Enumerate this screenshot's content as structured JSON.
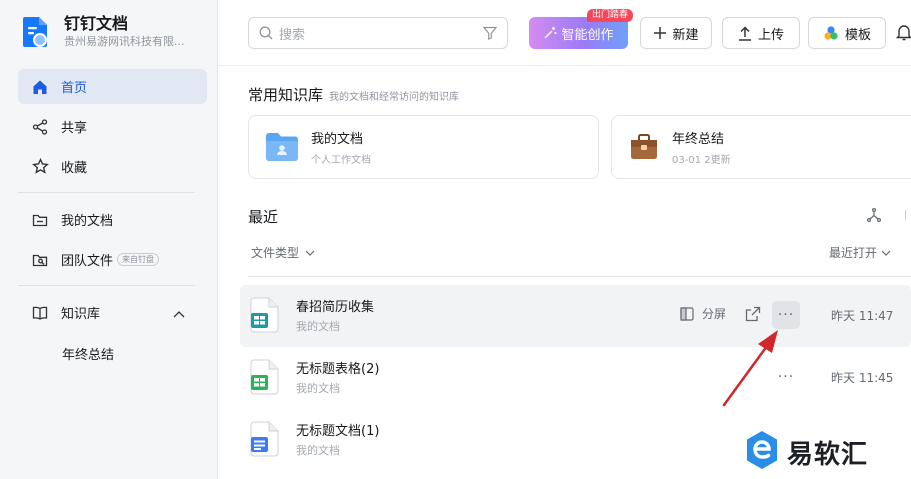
{
  "app": {
    "title": "钉钉文档",
    "org": "贵州易游网讯科技有限..."
  },
  "sidebar": {
    "items": [
      {
        "label": "首页",
        "icon": "home-icon"
      },
      {
        "label": "共享",
        "icon": "share-icon"
      },
      {
        "label": "收藏",
        "icon": "star-icon"
      },
      {
        "label": "我的文档",
        "icon": "folder-icon"
      },
      {
        "label": "团队文件",
        "icon": "team-folder-icon",
        "badge": "来自钉盘"
      },
      {
        "label": "知识库",
        "icon": "book-icon"
      }
    ],
    "sub_items": [
      {
        "label": "年终总结"
      }
    ]
  },
  "toolbar": {
    "search_placeholder": "搜索",
    "ai_label": "智能创作",
    "ai_tag": "出门踏春",
    "new_label": "新建",
    "upload_label": "上传",
    "template_label": "模板"
  },
  "knowledge": {
    "title": "常用知识库",
    "subtitle": "我的文档和经常访问的知识库",
    "cards": [
      {
        "title": "我的文档",
        "subtitle": "个人工作文档"
      },
      {
        "title": "年终总结",
        "subtitle": "03-01 2更新"
      }
    ]
  },
  "recent": {
    "title": "最近",
    "filter_label": "文件类型",
    "sort_label": "最近打开",
    "split_label": "分屏",
    "more_label": "···",
    "rows": [
      {
        "title": "春招简历收集",
        "location": "我的文档",
        "time": "昨天 11:47"
      },
      {
        "title": "无标题表格(2)",
        "location": "我的文档",
        "time": "昨天 11:45"
      },
      {
        "title": "无标题文档(1)",
        "location": "我的文档",
        "time": ""
      }
    ]
  },
  "watermark": {
    "text": "易软汇"
  },
  "colors": {
    "accent": "#1a5be0",
    "sidebar_bg": "#f5f6f7",
    "annotation_arrow": "#d0272b"
  }
}
